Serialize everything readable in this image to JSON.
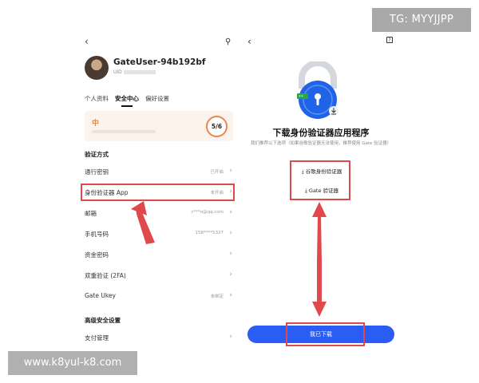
{
  "watermarks": {
    "top_right": "TG: MYYJJPP",
    "bottom_left": "www.k8yul-k8.com"
  },
  "left_screen": {
    "back_icon": "‹",
    "user_icon": "⚲",
    "username": "GateUser-94b192bf",
    "uid_label": "UID",
    "tabs": [
      "个人资料",
      "安全中心",
      "偏好设置"
    ],
    "active_tab": "安全中心",
    "security_level": "中",
    "security_score": "5/6",
    "section_verify": "验证方式",
    "rows": [
      {
        "label": "通行密钥",
        "value": "已开启"
      },
      {
        "label": "身份验证器 App",
        "value": "未开启"
      },
      {
        "label": "邮箱",
        "value": "c***o@qq.com"
      },
      {
        "label": "手机号码",
        "value": "158****5327"
      },
      {
        "label": "资金密码",
        "value": ""
      },
      {
        "label": "双重验证 (2FA)",
        "value": ""
      },
      {
        "label": "Gate Ukey",
        "value": "未绑定"
      }
    ],
    "section_advanced": "高级安全设置",
    "rows_advanced": [
      {
        "label": "支付管理",
        "value": ""
      }
    ]
  },
  "right_screen": {
    "back_icon": "‹",
    "help_icon": "?",
    "title": "下载身份验证器应用程序",
    "subtitle": "我们推荐以下选项（如果谷歌验证器无法使用，推荐使用 Gate 验证器）",
    "download_google": "谷歌身份验证器",
    "download_gate": "Gate 验证器",
    "confirm_button": "我已下载"
  },
  "colors": {
    "accent": "#2a5df4",
    "highlight": "#e0484b",
    "warning": "#e9874a",
    "lock_blue": "#1f63e6"
  }
}
